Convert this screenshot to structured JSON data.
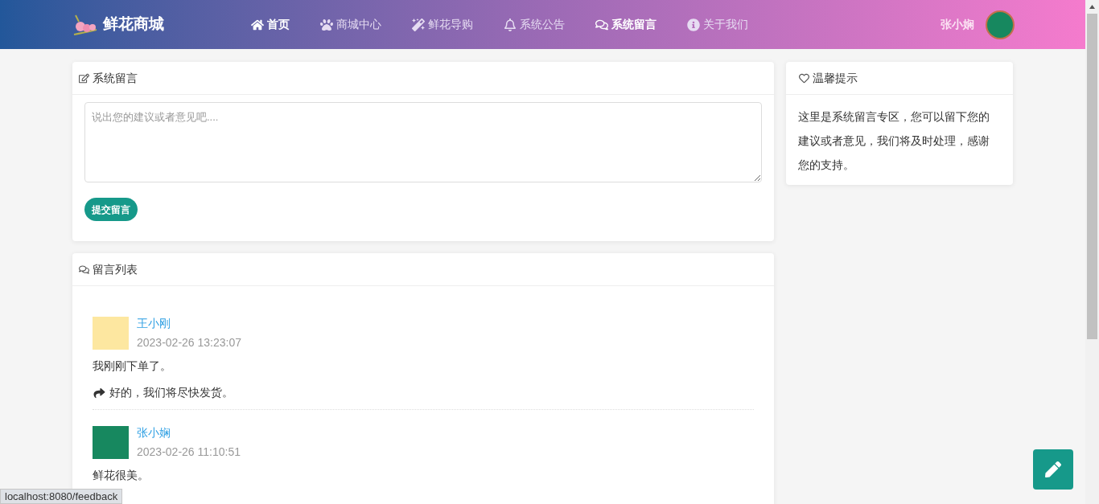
{
  "brand": {
    "name": "鲜花商城"
  },
  "nav": [
    {
      "label": "首页",
      "selected": true
    },
    {
      "label": "商城中心",
      "selected": false
    },
    {
      "label": "鲜花导购",
      "selected": false
    },
    {
      "label": "系统公告",
      "selected": false
    },
    {
      "label": "系统留言",
      "selected": true
    },
    {
      "label": "关于我们",
      "selected": false
    }
  ],
  "user": {
    "name": "张小娴"
  },
  "feedback_form": {
    "title": "系统留言",
    "placeholder": "说出您的建议或者意见吧....",
    "submit": "提交留言"
  },
  "message_list": {
    "title": "留言列表",
    "messages": [
      {
        "author": "王小刚",
        "time": "2023-02-26 13:23:07",
        "text": "我刚刚下单了。",
        "reply": "好的，我们将尽快发货。"
      },
      {
        "author": "张小娴",
        "time": "2023-02-26 11:10:51",
        "text": "鲜花很美。"
      }
    ]
  },
  "tips": {
    "title": "温馨提示",
    "text": "这里是系统留言专区，您可以留下您的建议或者意见，我们将及时处理，感谢您的支持。"
  },
  "status_bar": {
    "url": "localhost:8080/feedback"
  }
}
